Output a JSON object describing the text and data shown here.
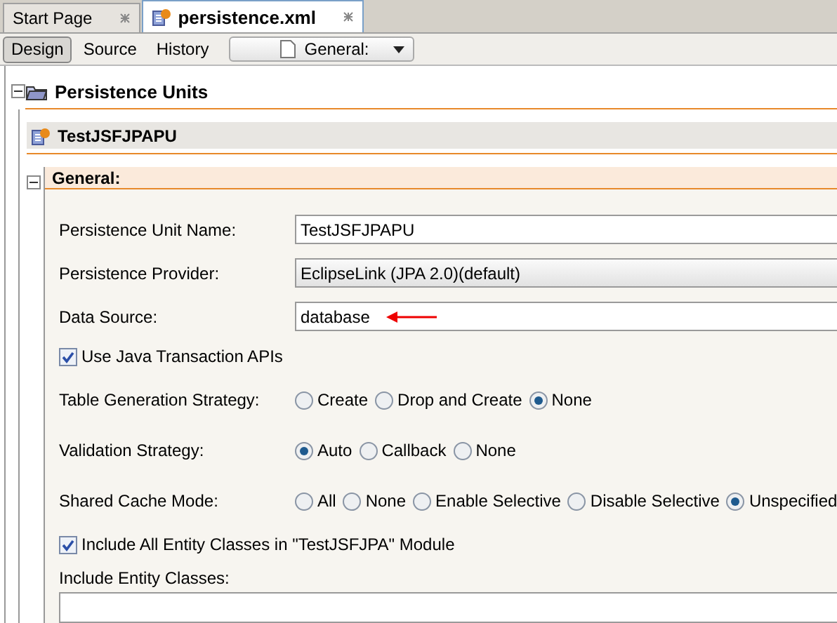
{
  "tabs": [
    {
      "label": "Start Page",
      "selected": false
    },
    {
      "label": "persistence.xml",
      "selected": true
    }
  ],
  "view_buttons": [
    {
      "label": "Design",
      "selected": true
    },
    {
      "label": "Source",
      "selected": false
    },
    {
      "label": "History",
      "selected": false
    }
  ],
  "section_dropdown": {
    "value": "General:"
  },
  "tree": {
    "title": "Persistence Units",
    "expanded": true,
    "unit": "TestJSFJPAPU",
    "section": {
      "title": "General:",
      "expanded": true
    }
  },
  "rows": [
    {
      "kind": "text",
      "label": "Persistence Unit Name:",
      "value": "TestJSFJPAPU",
      "annotated": false
    },
    {
      "kind": "dropdown",
      "label": "Persistence Provider:",
      "value": "EclipseLink (JPA 2.0)(default)"
    },
    {
      "kind": "text",
      "label": "Data Source:",
      "value": "database",
      "annotated": true
    },
    {
      "kind": "checkbox",
      "label": "Use Java Transaction APIs",
      "checked": true
    },
    {
      "kind": "radio",
      "label": "Table Generation Strategy:",
      "options": [
        {
          "label": "Create",
          "selected": false
        },
        {
          "label": "Drop and Create",
          "selected": false
        },
        {
          "label": "None",
          "selected": true
        }
      ]
    },
    {
      "kind": "radio",
      "label": "Validation Strategy:",
      "options": [
        {
          "label": "Auto",
          "selected": true
        },
        {
          "label": "Callback",
          "selected": false
        },
        {
          "label": "None",
          "selected": false
        }
      ]
    },
    {
      "kind": "radio",
      "label": "Shared Cache Mode:",
      "options": [
        {
          "label": "All",
          "selected": false
        },
        {
          "label": "None",
          "selected": false
        },
        {
          "label": "Enable Selective",
          "selected": false
        },
        {
          "label": "Disable Selective",
          "selected": false
        },
        {
          "label": "Unspecified",
          "selected": true
        }
      ]
    },
    {
      "kind": "checkbox",
      "label": "Include All Entity Classes in \"TestJSFJPA\" Module",
      "checked": true
    },
    {
      "kind": "list",
      "label": "Include Entity Classes:"
    }
  ]
}
